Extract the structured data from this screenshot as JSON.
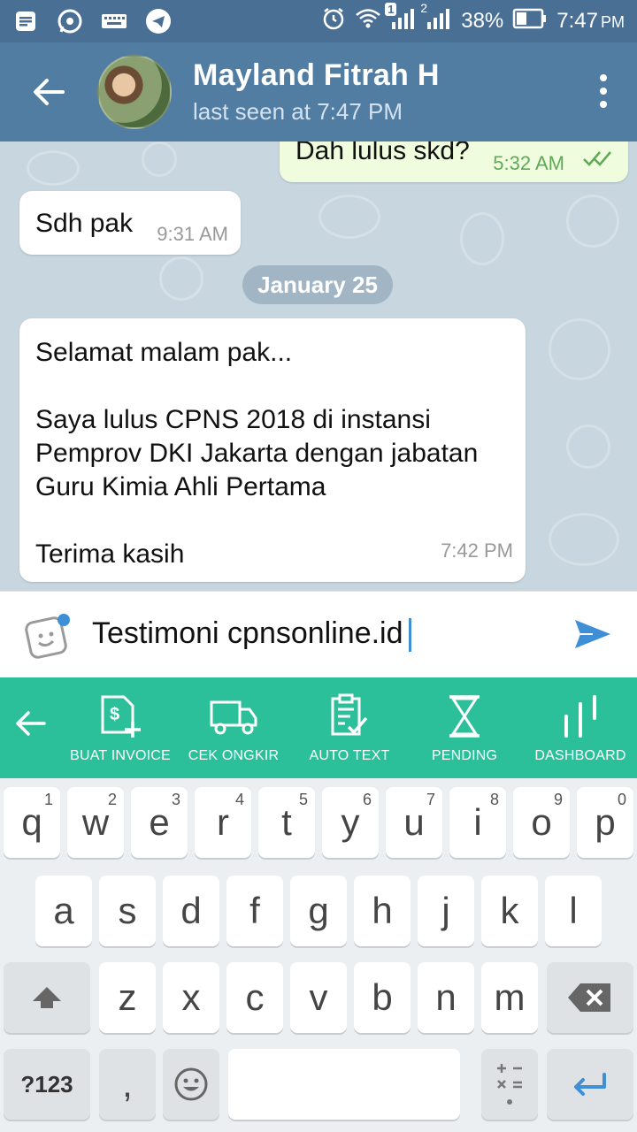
{
  "status_bar": {
    "battery": "38%",
    "time": "7:47",
    "ampm": "PM",
    "sim1_badge": "1",
    "sim2_badge": "2"
  },
  "header": {
    "contact_name": "Mayland Fitrah H",
    "last_seen": "last seen at 7:47 PM"
  },
  "messages": [
    {
      "direction": "out",
      "text": "Dah lulus skd?",
      "time": "5:32 AM",
      "status": "read"
    },
    {
      "direction": "in",
      "text": "Sdh pak",
      "time": "9:31 AM"
    },
    {
      "direction": "date",
      "text": "January 25"
    },
    {
      "direction": "in",
      "lines": [
        "Selamat malam pak...",
        "",
        "Saya lulus CPNS 2018 di instansi",
        "Pemprov DKI Jakarta dengan jabatan",
        "Guru Kimia Ahli Pertama",
        "",
        "Terima kasih"
      ],
      "time": "7:42 PM"
    }
  ],
  "composer": {
    "text": "Testimoni cpnsonline.id"
  },
  "toolbar": {
    "items": [
      {
        "label": "BUAT INVOICE",
        "icon": "invoice-icon"
      },
      {
        "label": "CEK ONGKIR",
        "icon": "truck-icon"
      },
      {
        "label": "AUTO TEXT",
        "icon": "clipboard-check-icon"
      },
      {
        "label": "PENDING",
        "icon": "hourglass-icon"
      },
      {
        "label": "DASHBOARD",
        "icon": "bars-icon"
      }
    ]
  },
  "keyboard": {
    "row1": [
      {
        "key": "q",
        "hint": "1"
      },
      {
        "key": "w",
        "hint": "2"
      },
      {
        "key": "e",
        "hint": "3"
      },
      {
        "key": "r",
        "hint": "4"
      },
      {
        "key": "t",
        "hint": "5"
      },
      {
        "key": "y",
        "hint": "6"
      },
      {
        "key": "u",
        "hint": "7"
      },
      {
        "key": "i",
        "hint": "8"
      },
      {
        "key": "o",
        "hint": "9"
      },
      {
        "key": "p",
        "hint": "0"
      }
    ],
    "row2": [
      "a",
      "s",
      "d",
      "f",
      "g",
      "h",
      "j",
      "k",
      "l"
    ],
    "row3": [
      "z",
      "x",
      "c",
      "v",
      "b",
      "n",
      "m"
    ],
    "symbols_label": "?123",
    "comma": ","
  },
  "colors": {
    "status_bar": "#4a6f95",
    "app_bar": "#527da3",
    "chat_bg": "#c7d6df",
    "outgoing_bubble": "#effdde",
    "toolbar": "#2bbf9a",
    "accent_blue": "#3e8fd6"
  }
}
